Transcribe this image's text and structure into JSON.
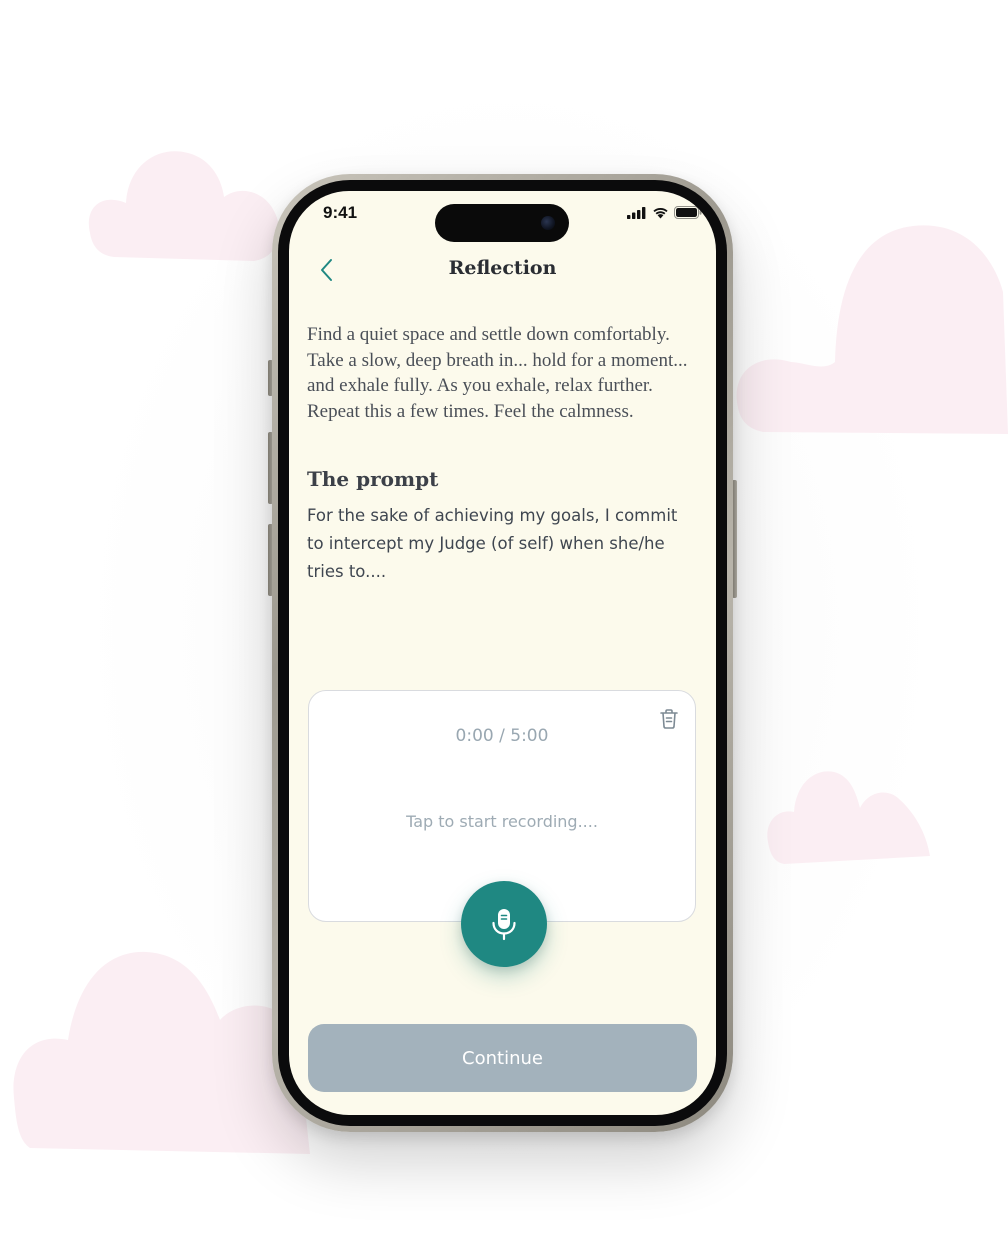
{
  "status_bar": {
    "time": "9:41",
    "icons": [
      "cellular-signal-icon",
      "wifi-icon",
      "battery-icon"
    ]
  },
  "header": {
    "back_icon": "chevron-left-icon",
    "title": "Reflection"
  },
  "intro_text": "Find a quiet space and settle down comfortably. Take a slow, deep breath in... hold for a moment... and exhale fully. As you exhale, relax further. Repeat this a few times. Feel the calmness.",
  "prompt": {
    "heading": "The prompt",
    "text": "For the sake of achieving my goals, I commit to intercept my Judge (of self) when she/he tries to...."
  },
  "recorder": {
    "timer": "0:00 / 5:00",
    "hint": "Tap to start recording....",
    "delete_icon": "trash-icon",
    "mic_icon": "microphone-icon"
  },
  "continue_label": "Continue",
  "colors": {
    "screen_background": "#fcfaec",
    "accent": "#1f8882",
    "continue_disabled": "#a3b2bc",
    "cloud": "#fbeef3"
  }
}
